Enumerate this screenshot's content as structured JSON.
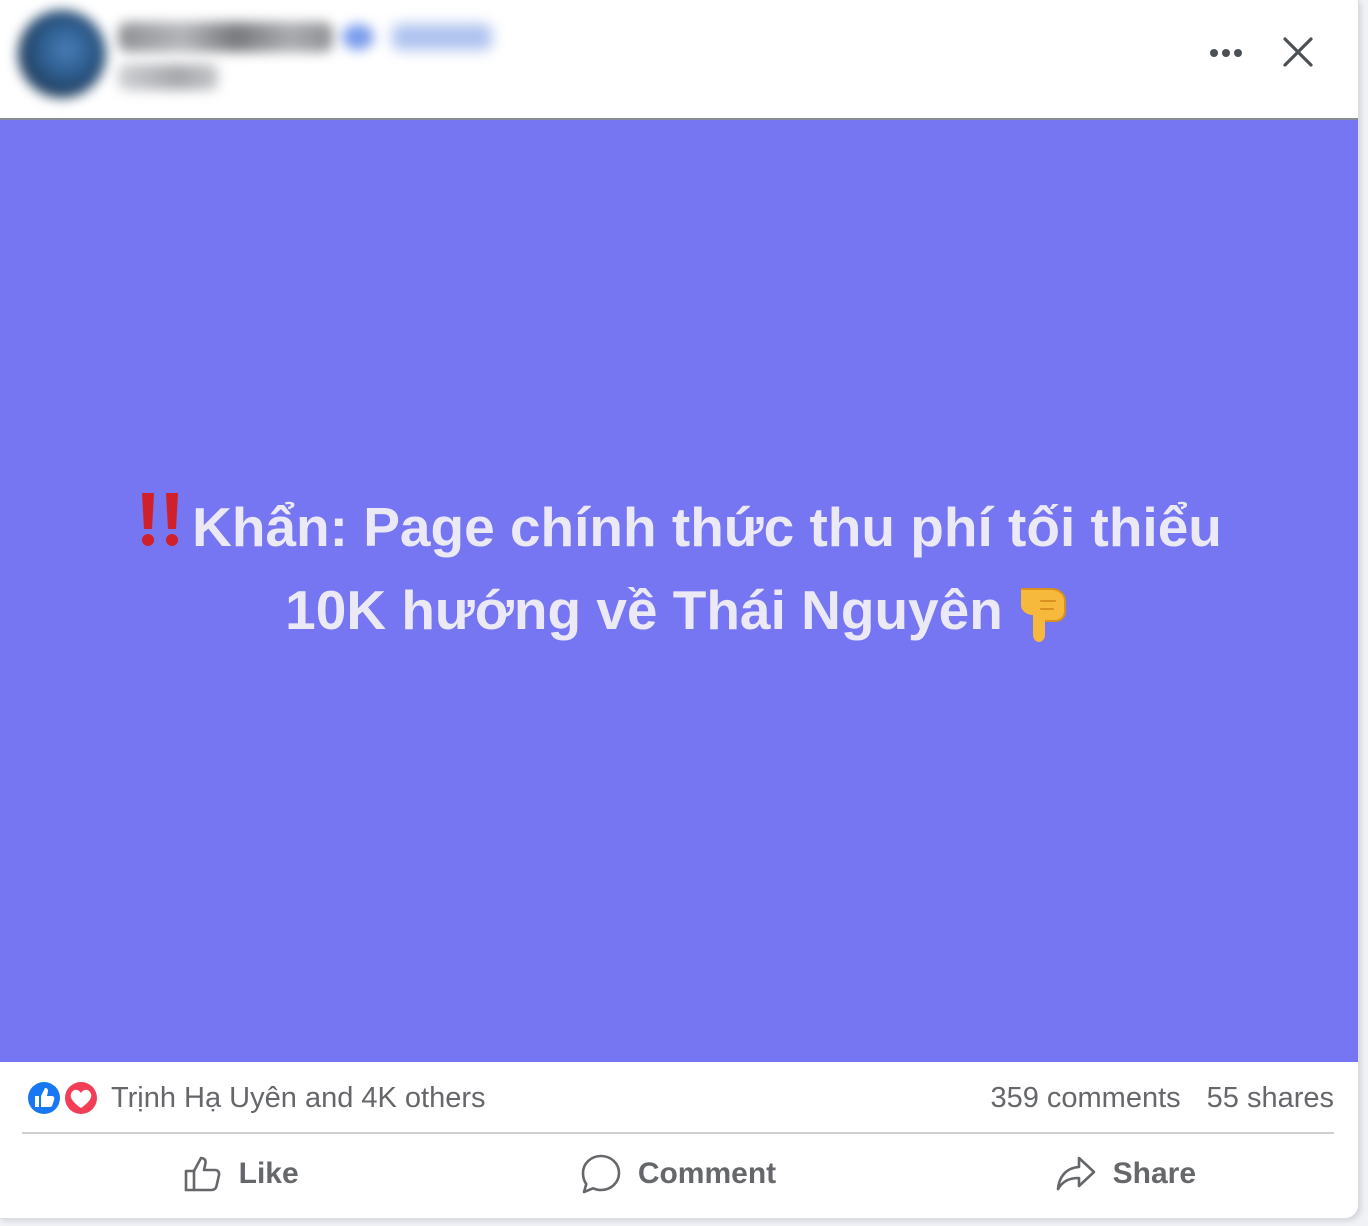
{
  "header": {
    "author_name": "",
    "author_meta": "",
    "more_icon": "more-horizontal-icon",
    "close_icon": "close-icon"
  },
  "post": {
    "background_color": "#7675f2",
    "text_color": "#ece9f6",
    "line1_text": "Khẩn: Page chính thức thu phí tối thiểu",
    "line2_text": "10K hướng về Thái Nguyên",
    "lead_icon": "double-exclamation-icon",
    "trail_icon": "pointing-down-hand-icon"
  },
  "reactions": {
    "icons": [
      "like-reaction-icon",
      "love-reaction-icon"
    ],
    "summary": "Trịnh Hạ Uyên and 4K others",
    "comments": "359 comments",
    "shares": "55 shares"
  },
  "actions": {
    "like_label": "Like",
    "comment_label": "Comment",
    "share_label": "Share"
  },
  "colors": {
    "like_blue": "#1877f2",
    "love_red": "#f33e58",
    "muted_text": "#65676b"
  }
}
